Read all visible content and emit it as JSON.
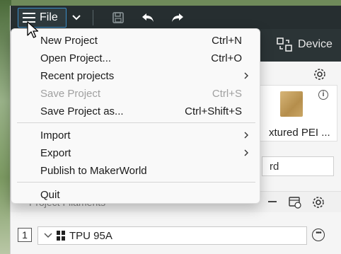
{
  "titlebar": {
    "file_label": "File",
    "icons": [
      "menu-icon",
      "chevron-down-icon",
      "save-icon",
      "undo-icon",
      "redo-icon"
    ]
  },
  "toolbar": {
    "device_label": "Device"
  },
  "menu": {
    "items": [
      {
        "label": "New Project",
        "shortcut": "Ctrl+N",
        "enabled": true,
        "submenu": false
      },
      {
        "label": "Open Project...",
        "shortcut": "Ctrl+O",
        "enabled": true,
        "submenu": false
      },
      {
        "label": "Recent projects",
        "shortcut": "",
        "enabled": true,
        "submenu": true
      },
      {
        "label": "Save Project",
        "shortcut": "Ctrl+S",
        "enabled": false,
        "submenu": false
      },
      {
        "label": "Save Project as...",
        "shortcut": "Ctrl+Shift+S",
        "enabled": true,
        "submenu": false
      },
      {
        "label": "Import",
        "shortcut": "",
        "enabled": true,
        "submenu": true
      },
      {
        "label": "Export",
        "shortcut": "",
        "enabled": true,
        "submenu": true
      },
      {
        "label": "Publish to MakerWorld",
        "shortcut": "",
        "enabled": true,
        "submenu": false
      },
      {
        "label": "Quit",
        "shortcut": "",
        "enabled": true,
        "submenu": false
      }
    ]
  },
  "panel": {
    "plate_label": "xtured PEI ...",
    "search_value": "rd",
    "filament_header": "Project Filaments",
    "filament_slot": "1",
    "filament_name": "TPU 95A"
  },
  "colors": {
    "titlebar": "#262e30",
    "accent": "#3c8ec8",
    "menu_bg": "#f9f9f9",
    "disabled_text": "#a0a0a0"
  }
}
